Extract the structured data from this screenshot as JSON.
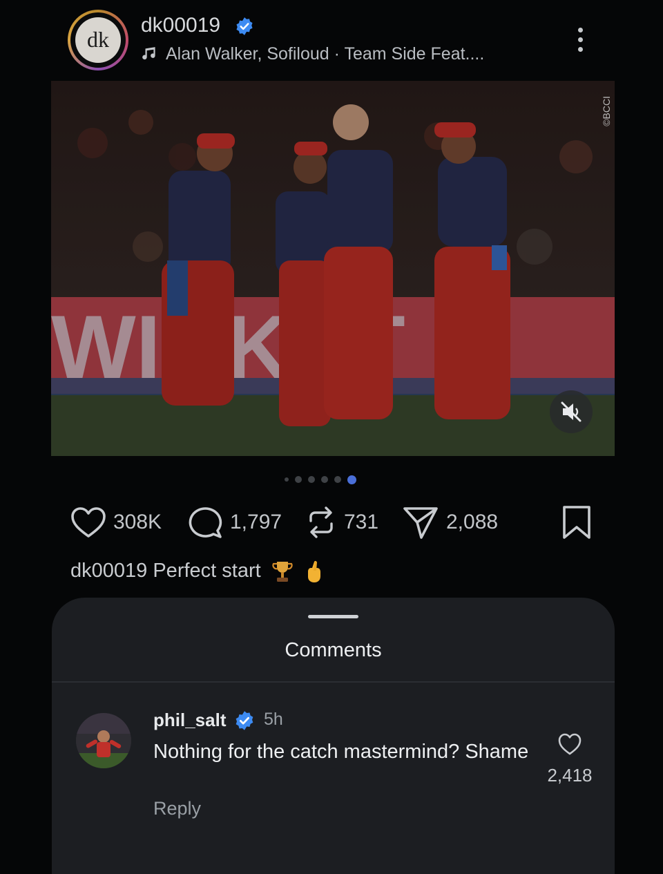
{
  "post": {
    "username": "dk00019",
    "avatar_text": "dk",
    "music": "Alan Walker, Sofiloud · Team Side Feat....",
    "watermark": "©BCCI",
    "carousel": {
      "count": 6,
      "active_index": 5
    }
  },
  "actions": {
    "likes": "308K",
    "comments": "1,797",
    "reposts": "731",
    "shares": "2,088"
  },
  "caption": {
    "user": "dk00019",
    "text": "Perfect start"
  },
  "comments_sheet": {
    "title": "Comments",
    "items": [
      {
        "user": "phil_salt",
        "time": "5h",
        "text": "Nothing for the catch mastermind? Shame",
        "reply_label": "Reply",
        "likes": "2,418"
      }
    ]
  },
  "colors": {
    "background": "#050607",
    "sheet": "#1c1e22",
    "verified": "#3d8bf2",
    "carousel_active": "#4a6fd8"
  },
  "icons": [
    "verified-badge-icon",
    "music-note-icon",
    "more-options-icon",
    "mute-icon",
    "heart-icon",
    "comment-icon",
    "repost-icon",
    "share-icon",
    "bookmark-icon"
  ]
}
